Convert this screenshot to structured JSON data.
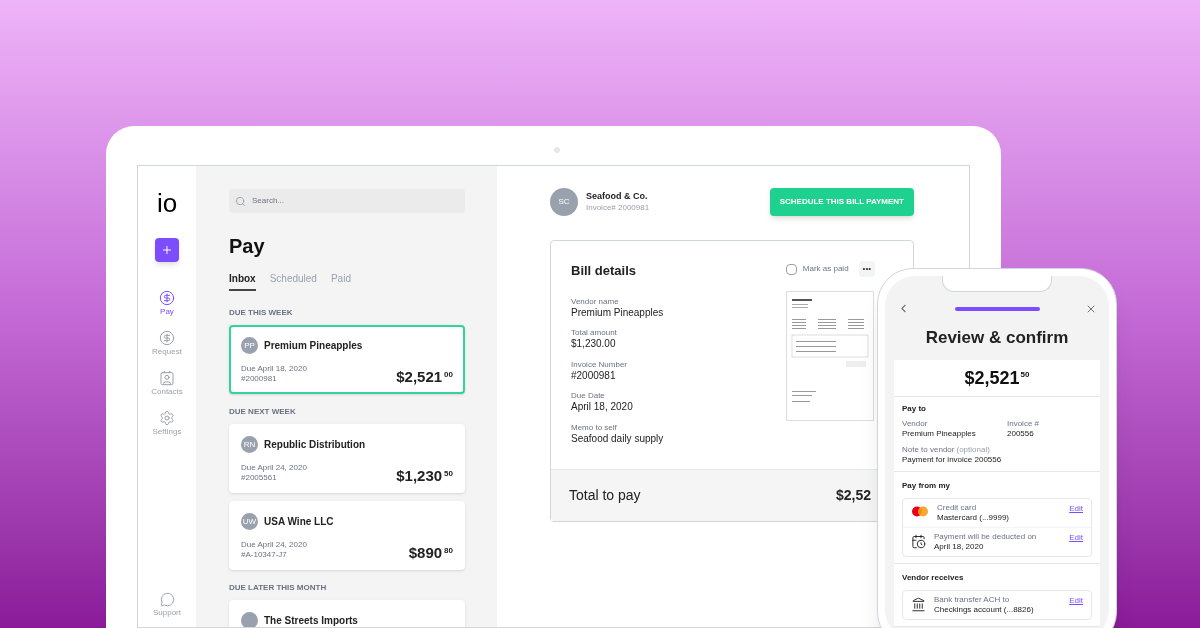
{
  "sidebar": {
    "logo": "io",
    "items": [
      {
        "label": "Pay",
        "selected": true,
        "kind": "pay"
      },
      {
        "label": "Request",
        "selected": false,
        "kind": "request"
      },
      {
        "label": "Contacts",
        "selected": false,
        "kind": "contacts"
      },
      {
        "label": "Settings",
        "selected": false,
        "kind": "settings"
      }
    ],
    "support": "Support"
  },
  "list": {
    "search": {
      "placeholder": "Search..."
    },
    "title": "Pay",
    "tabs": [
      {
        "label": "Inbox",
        "selected": true
      },
      {
        "label": "Scheduled",
        "selected": false
      },
      {
        "label": "Paid",
        "selected": false
      }
    ],
    "groups": [
      {
        "heading": "DUE THIS WEEK",
        "bills": [
          {
            "initials": "PP",
            "name": "Premium Pineapples",
            "due": "Due April 18, 2020",
            "number": "#2000981",
            "amount": "$2,521",
            "cents": "00",
            "selected": true
          }
        ]
      },
      {
        "heading": "DUE NEXT WEEK",
        "bills": [
          {
            "initials": "RN",
            "name": "Republic Distribution",
            "due": "Due April 24, 2020",
            "number": "#2005561",
            "amount": "$1,230",
            "cents": "50",
            "selected": false
          },
          {
            "initials": "UW",
            "name": "USA Wine LLC",
            "due": "Due April 24, 2020",
            "number": "#A-10347-J7",
            "amount": "$890",
            "cents": "80",
            "selected": false
          }
        ]
      },
      {
        "heading": "DUE LATER THIS MONTH",
        "bills": [
          {
            "name": "The Streets Imports",
            "selected": false
          }
        ]
      }
    ]
  },
  "detail": {
    "vendor": {
      "initials": "SC",
      "name": "Seafood & Co.",
      "invoice": "Invoice# 2000981"
    },
    "button": "SCHEDULE THIS BILL PAYMENT",
    "card": {
      "title": "Bill details",
      "mark_paid": {
        "label": "Mark as paid",
        "checked": false
      },
      "more": "•••",
      "fields": [
        {
          "label": "Vendor name",
          "value": "Premium Pineapples"
        },
        {
          "label": "Total amount",
          "value": "$1,230.00"
        },
        {
          "label": "Invoice Number",
          "value": "#2000981"
        },
        {
          "label": "Due Date",
          "value": "April 18, 2020"
        },
        {
          "label": "Memo to self",
          "value": "Seafood daily supply"
        }
      ],
      "total_label": "Total to pay",
      "total_value": "$2,52"
    }
  },
  "phone": {
    "title": "Review & confirm",
    "progress": {
      "level": 1
    },
    "amount": "$2,521",
    "cents": "50",
    "pay_to": {
      "heading": "Pay to",
      "vendor_label": "Vendor",
      "vendor": "Premium Pineapples",
      "invoice_label": "Invoice #",
      "invoice": "200556",
      "note_label": "Note to vendor",
      "note_hint": "(optional)",
      "note": "Payment for invoice 200556"
    },
    "pay_from": {
      "heading": "Pay from my",
      "rows": [
        {
          "kind": "card",
          "label": "Credit card",
          "value": "Mastercard (...9999)",
          "action": "Edit"
        },
        {
          "kind": "date",
          "label": "Payment will be deducted on",
          "value": "April 18, 2020",
          "action": "Edit"
        }
      ]
    },
    "vendor_receives": {
      "heading": "Vendor receives",
      "rows": [
        {
          "kind": "bank",
          "label": "Bank transfer ACH to",
          "value": "Checkings account (...8826)",
          "action": "Edit"
        }
      ]
    }
  }
}
